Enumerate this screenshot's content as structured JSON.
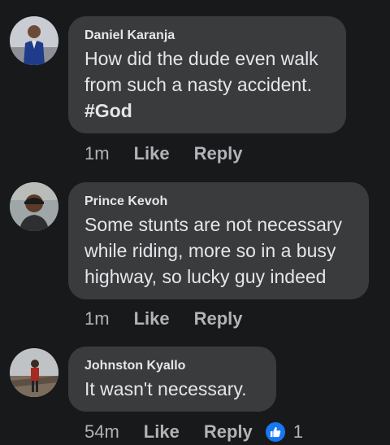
{
  "comments": [
    {
      "author": "Daniel Karanja",
      "text": "How did the dude even walk from such a nasty accident.",
      "hashtag": "#God",
      "time": "1m",
      "like_label": "Like",
      "reply_label": "Reply"
    },
    {
      "author": "Prince Kevoh",
      "text": "Some stunts are not necessary while riding, more so in a busy highway, so lucky guy indeed",
      "time": "1m",
      "like_label": "Like",
      "reply_label": "Reply"
    },
    {
      "author": "Johnston Kyallo",
      "text": "It wasn't necessary.",
      "time": "54m",
      "like_label": "Like",
      "reply_label": "Reply",
      "reaction_icon": "thumbs-up-icon",
      "reaction_count": "1"
    }
  ],
  "colors": {
    "background": "#18191a",
    "bubble": "#3a3b3c",
    "text_primary": "#e4e6eb",
    "text_secondary": "#b0b3b8",
    "like_blue": "#1877f2"
  }
}
